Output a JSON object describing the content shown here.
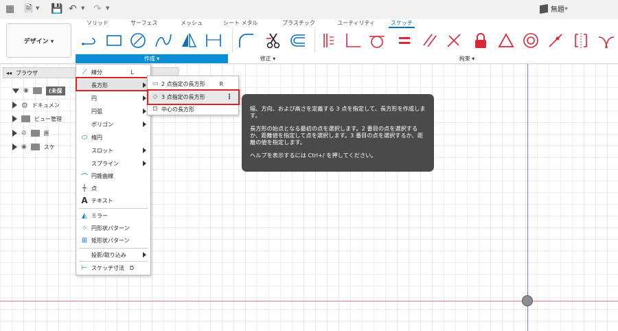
{
  "window": {
    "doc_title": "無題*"
  },
  "tabs": [
    {
      "label": "ソリッド",
      "active": false
    },
    {
      "label": "サーフェス",
      "active": false
    },
    {
      "label": "メッシュ",
      "active": false
    },
    {
      "label": "シート メタル",
      "active": false
    },
    {
      "label": "プラスチック",
      "active": false
    },
    {
      "label": "ユーティリティ",
      "active": false
    },
    {
      "label": "スケッチ",
      "active": true
    }
  ],
  "workspace": {
    "label": "デザイン ▾"
  },
  "groups": {
    "create": "作成 ▾",
    "modify": "修正 ▾",
    "constrain": "拘束 ▾"
  },
  "browser": {
    "title": "ブラウザ",
    "root": "(未保",
    "items": [
      "ドキュメン",
      "ビュー管理",
      "原",
      "スケ"
    ]
  },
  "menu": {
    "items": [
      {
        "label": "線分",
        "shortcut": "L",
        "icon": "line-icon",
        "glyph": "⟋"
      },
      {
        "label": "長方形",
        "shortcut": "",
        "icon": "rectangle-icon",
        "glyph": "",
        "submenu": true
      },
      {
        "label": "円",
        "shortcut": "",
        "icon": "circle-icon",
        "glyph": "",
        "submenu": true
      },
      {
        "label": "円弧",
        "shortcut": "",
        "icon": "arc-icon",
        "glyph": "",
        "submenu": true
      },
      {
        "label": "ポリゴン",
        "shortcut": "",
        "icon": "polygon-icon",
        "glyph": "",
        "submenu": true
      },
      {
        "label": "楕円",
        "shortcut": "",
        "icon": "ellipse-icon",
        "glyph": "⬭"
      },
      {
        "label": "スロット",
        "shortcut": "",
        "icon": "slot-icon",
        "glyph": "",
        "submenu": true
      },
      {
        "label": "スプライン",
        "shortcut": "",
        "icon": "spline-icon",
        "glyph": "",
        "submenu": true
      },
      {
        "label": "円錐曲線",
        "shortcut": "",
        "icon": "conic-icon",
        "glyph": "⌒"
      },
      {
        "label": "点",
        "shortcut": "",
        "icon": "point-icon",
        "glyph": "┼"
      },
      {
        "label": "テキスト",
        "shortcut": "",
        "icon": "text-icon",
        "glyph": "A"
      },
      {
        "label": "ミラー",
        "shortcut": "",
        "icon": "mirror-icon",
        "glyph": "◭"
      },
      {
        "label": "円形状パターン",
        "shortcut": "",
        "icon": "circular-pattern-icon",
        "glyph": "⁘"
      },
      {
        "label": "矩形状パターン",
        "shortcut": "",
        "icon": "rectangular-pattern-icon",
        "glyph": "⊞"
      },
      {
        "label": "投影/取り込み",
        "shortcut": "",
        "icon": "project-icon",
        "glyph": "",
        "submenu": true
      },
      {
        "label": "スケッチ寸法",
        "shortcut": "D",
        "icon": "dimension-icon",
        "glyph": "⊢"
      }
    ]
  },
  "submenu": {
    "items": [
      {
        "label": "2 点指定の長方形",
        "shortcut": "R",
        "glyph": "▭"
      },
      {
        "label": "3 点指定の長方形",
        "shortcut": "",
        "glyph": "◇"
      },
      {
        "label": "中心の長方形",
        "shortcut": "",
        "glyph": "⊡"
      }
    ]
  },
  "tooltip": {
    "p1": "幅、方向、および高さを定義する 3 点を指定して、長方形を作成します。",
    "p2": "長方形の始点となる最初の点を選択します。2 番目の点を選択するか、距離値を指定して点を選択します。3 番目の点を選択するか、距離の値を指定します。",
    "p3": "ヘルプを表示するには Ctrl+/ を押してください。"
  },
  "colors": {
    "accent": "#0a8fd6",
    "highlight_box": "#e02020",
    "constraint_red": "#d8283a"
  }
}
